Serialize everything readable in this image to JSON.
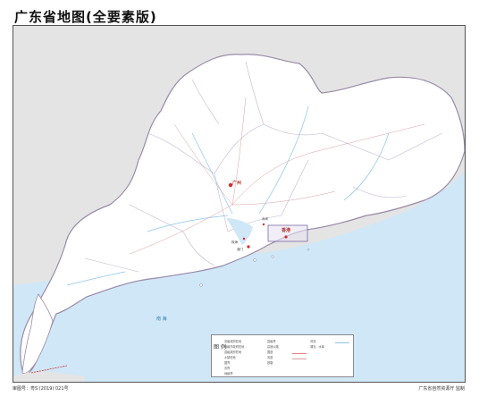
{
  "title": "广东省地图(全要素版)",
  "footer": {
    "left": "审图号：粤S (2019) 021号",
    "right": "广东省自然资源厅 监制"
  },
  "cities": {
    "capital": "广州",
    "hongkong": "香港",
    "macau": "澳门",
    "shenzhen": "深圳",
    "zhuhai": "珠海"
  },
  "sea_label": "南 海",
  "legend": {
    "title": "图 例",
    "rows": [
      "省级政府驻地",
      "地级市政府驻地",
      "县级政府驻地",
      "乡镇驻地",
      "国界",
      "省界",
      "地级界",
      "县级界",
      "高速公路",
      "国道",
      "省道",
      "铁路",
      "河流",
      "湖泊、水库"
    ]
  },
  "colors": {
    "sea": "#cfe7f7",
    "land": "#ffffff",
    "outside": "#e4e4e4",
    "boundary": "#9a8aa8",
    "river": "#8cc4ea",
    "road": "#d9a0a0",
    "capital": "#d62a2a"
  }
}
